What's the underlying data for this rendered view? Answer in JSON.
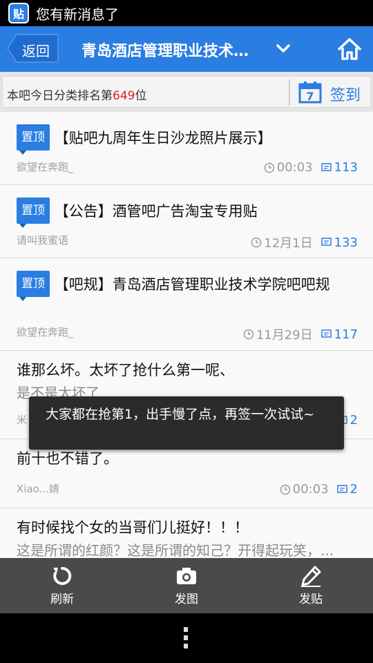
{
  "status": {
    "notification": "您有新消息了",
    "app_icon_text": "贴"
  },
  "header": {
    "back_label": "返回",
    "title": "青岛酒店管理职业技术学院吧"
  },
  "rank": {
    "prefix": "本吧今日分类排名第",
    "number": "649",
    "suffix": "位",
    "signin_label": "签到",
    "calendar_day": "7"
  },
  "posts": [
    {
      "badge": "置顶",
      "title": "【贴吧九周年生日沙龙照片展示】",
      "author": "欲望在奔跑_",
      "time": "00:03",
      "replies": "113"
    },
    {
      "badge": "置顶",
      "title": "【公告】酒管吧广告淘宝专用贴",
      "author": "请叫我蜜语",
      "time": "12月1日",
      "replies": "133"
    },
    {
      "badge": "置顶",
      "title": "【吧规】青岛酒店管理职业技术学院吧吧规",
      "author": "欲望在奔跑_",
      "time": "11月29日",
      "replies": "117"
    },
    {
      "title": "谁那么坏。太坏了抢什么第一呢、",
      "subtitle": "是不是太坏了",
      "author": "米",
      "replies": "2"
    },
    {
      "title": "前十也不错了。",
      "author": "Xiao...婧",
      "time": "00:03",
      "replies": "2"
    },
    {
      "title": "有时候找个女的当哥们儿挺好！！！",
      "subtitle": "这是所谓的红颜？这是所谓的知己？开得起玩笑，..."
    }
  ],
  "toast": {
    "message": "大家都在抢第1，出手慢了点，再签一次试试~"
  },
  "toolbar": {
    "refresh_label": "刷新",
    "photo_label": "发图",
    "post_label": "发贴"
  },
  "colors": {
    "brand": "#2a7de1",
    "rank_number": "#e02020",
    "toolbar_bg": "#4a4a4a"
  }
}
